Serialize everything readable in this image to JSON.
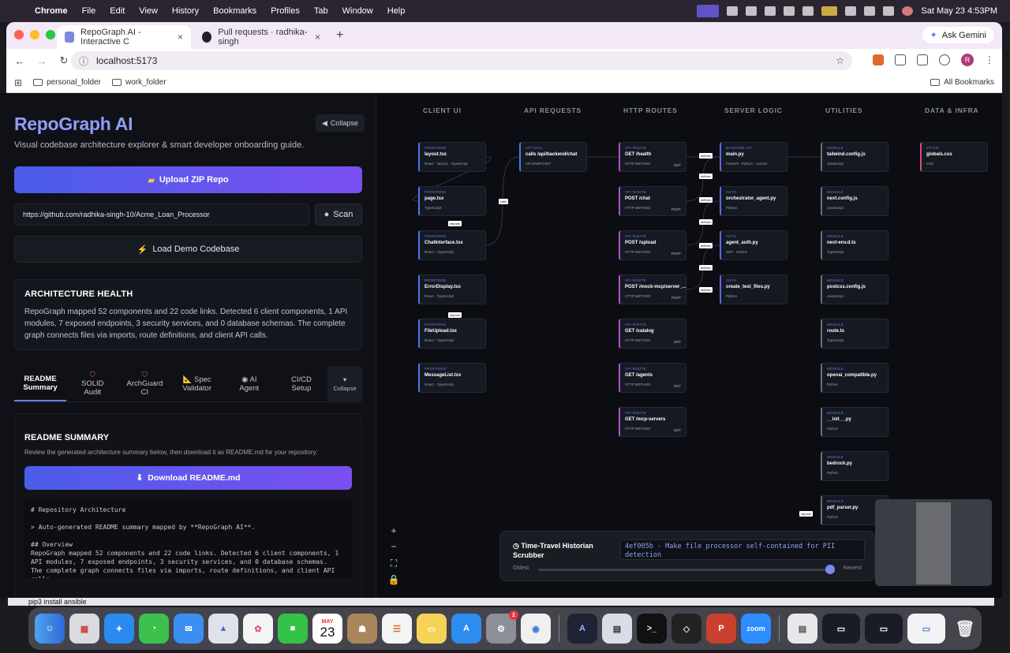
{
  "menubar": {
    "app": "Chrome",
    "items": [
      "File",
      "Edit",
      "View",
      "History",
      "Bookmarks",
      "Profiles",
      "Tab",
      "Window",
      "Help"
    ],
    "datetime": "Sat May 23  4:53PM"
  },
  "browser": {
    "tabs": [
      {
        "title": "RepoGraph AI - Interactive C",
        "active": true
      },
      {
        "title": "Pull requests · radhika-singh",
        "active": false
      }
    ],
    "ask_gemini": "Ask Gemini",
    "url": "localhost:5173",
    "profile_initial": "R",
    "bookmarks": [
      "personal_folder",
      "work_folder"
    ],
    "all_bookmarks": "All Bookmarks"
  },
  "sidebar": {
    "title": "RepoGraph AI",
    "subtitle": "Visual codebase architecture explorer & smart developer onboarding guide.",
    "collapse": "Collapse",
    "upload_button": "Upload ZIP Repo",
    "repo_url": "https://github.com/radhika-singh-10/Acme_Loan_Processor",
    "scan_button": "Scan",
    "demo_button": "Load Demo Codebase",
    "health": {
      "heading": "ARCHITECTURE HEALTH",
      "text": "RepoGraph mapped 52 components and 22 code links. Detected 6 client components, 1 API modules, 7 exposed endpoints, 3 security services, and 0 database schemas. The complete graph connects files via imports, route definitions, and client API calls."
    },
    "tabs": [
      {
        "line1": "README",
        "line2": "Summary"
      },
      {
        "line1": "SOLID",
        "line2": "Audit"
      },
      {
        "line1": "ArchGuard",
        "line2": "CI"
      },
      {
        "line1": "Spec",
        "line2": "Validator"
      },
      {
        "line1": "AI",
        "line2": "Agent"
      },
      {
        "line1": "CI/CD",
        "line2": "Setup"
      }
    ],
    "tabs_collapse": "Collapse",
    "readme": {
      "heading": "README SUMMARY",
      "desc": "Review the generated architecture summary below, then download it as README.md for your repository:",
      "download": "Download README.md",
      "code": "# Repository Architecture\n\n> Auto-generated README summary mapped by **RepoGraph AI**.\n\n## Overview\nRepoGraph mapped 52 components and 22 code links. Detected 6 client components, 1 API modules, 7 exposed endpoints, 3 security services, and 0 database schemas.\nThe complete graph connects files via imports, route definitions, and client API calls."
    }
  },
  "graph": {
    "columns": [
      "CLIENT UI",
      "API REQUESTS",
      "HTTP ROUTES",
      "SERVER LOGIC",
      "UTILITIES",
      "DATA & INFRA"
    ],
    "client": [
      {
        "type": "FRONTEND",
        "name": "layout.tsx",
        "tags": "React · Next.js · TypeScript"
      },
      {
        "type": "FRONTEND",
        "name": "page.tsx",
        "tags": "TypeScript"
      },
      {
        "type": "FRONTEND",
        "name": "ChatInterface.tsx",
        "tags": "React · TypeScript"
      },
      {
        "type": "FRONTEND",
        "name": "ErrorDisplay.tsx",
        "tags": "React · TypeScript"
      },
      {
        "type": "FRONTEND",
        "name": "FileUpload.tsx",
        "tags": "React · TypeScript"
      },
      {
        "type": "FRONTEND",
        "name": "MessageList.tsx",
        "tags": "React · TypeScript"
      }
    ],
    "api": [
      {
        "type": "API CALL",
        "name": "calls /api/backend/chat",
        "tags": "API ENDPOINT"
      }
    ],
    "routes": [
      {
        "type": "API ROUTE",
        "name": "GET /health",
        "tags": "HTTP METHOD",
        "method": "GET"
      },
      {
        "type": "API ROUTE",
        "name": "POST /chat",
        "tags": "HTTP METHOD",
        "method": "POST"
      },
      {
        "type": "API ROUTE",
        "name": "POST /upload",
        "tags": "HTTP METHOD",
        "method": "POST"
      },
      {
        "type": "API ROUTE",
        "name": "POST /mock-mcp/server_...",
        "tags": "HTTP METHOD",
        "method": "POST"
      },
      {
        "type": "API ROUTE",
        "name": "GET /catalog",
        "tags": "HTTP METHOD",
        "method": "GET"
      },
      {
        "type": "API ROUTE",
        "name": "GET /agents",
        "tags": "HTTP METHOD",
        "method": "GET"
      },
      {
        "type": "API ROUTE",
        "name": "GET /mcp-servers",
        "tags": "HTTP METHOD",
        "method": "GET"
      }
    ],
    "server": [
      {
        "type": "BACKEND API",
        "name": "main.py",
        "tags": "FastAPI · Python · uvicorn"
      },
      {
        "type": "AUTH",
        "name": "orchestrator_agent.py",
        "tags": "Python"
      },
      {
        "type": "AUTH",
        "name": "agent_auth.py",
        "tags": "JWT · Python"
      },
      {
        "type": "AUTH",
        "name": "create_test_files.py",
        "tags": "Python"
      }
    ],
    "utils": [
      {
        "type": "MODULE",
        "name": "tailwind.config.js",
        "tags": "JavaScript"
      },
      {
        "type": "MODULE",
        "name": "next.config.js",
        "tags": "JavaScript"
      },
      {
        "type": "MODULE",
        "name": "next-env.d.ts",
        "tags": "TypeScript"
      },
      {
        "type": "MODULE",
        "name": "postcss.config.js",
        "tags": "JavaScript"
      },
      {
        "type": "MODULE",
        "name": "route.ts",
        "tags": "TypeScript"
      },
      {
        "type": "MODULE",
        "name": "openai_compatible.py",
        "tags": "Python"
      },
      {
        "type": "MODULE",
        "name": "__init__.py",
        "tags": "Python"
      },
      {
        "type": "MODULE",
        "name": "bedrock.py",
        "tags": "Python"
      },
      {
        "type": "MODULE",
        "name": "pdf_parser.py",
        "tags": "Python"
      }
    ],
    "data": [
      {
        "type": "STYLE",
        "name": "globals.css",
        "tags": "CSS"
      }
    ],
    "edge_labels": [
      "imports",
      "calls",
      "defines"
    ]
  },
  "scrubber": {
    "title": "Time-Travel Historian Scrubber",
    "commit": "4ef005b - Make file processor self-contained for PII detection",
    "oldest": "Oldest",
    "newest": "Newest",
    "position": 0.985
  },
  "terminal_line": "pip3 install ansible",
  "dock": {
    "calendar_month": "MAY",
    "calendar_day": "23",
    "settings_badge": "2",
    "zoom": "zoom"
  }
}
